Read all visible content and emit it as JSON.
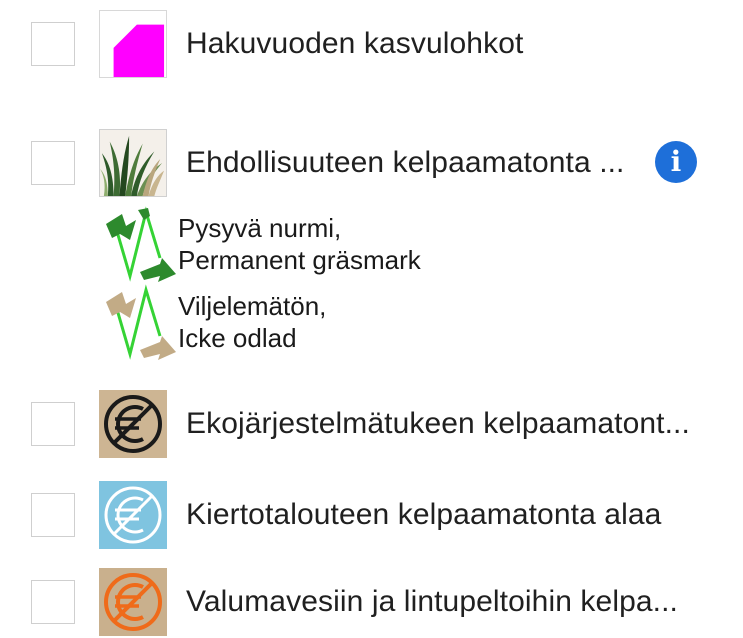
{
  "layers": [
    {
      "label": "Hakuvuoden kasvulohkot",
      "icon": "magenta-parcel-icon",
      "color": "#ff00ff"
    },
    {
      "label": "Ehdollisuuteen kelpaamatonta ...",
      "icon": "grass-icon",
      "info": "i"
    },
    {
      "label": "Ekojärjestelmätukeen kelpaamatont...",
      "icon": "crossed-euro-icon",
      "bg": "#cdb593",
      "stroke": "#1a1a1a"
    },
    {
      "label": "Kiertotalouteen kelpaamatonta alaa",
      "icon": "crossed-euro-icon",
      "bg": "#7fc4e0",
      "stroke": "#ffffff"
    },
    {
      "label": "Valumavesiin ja lintupeltoihin kelpa...",
      "icon": "crossed-euro-icon",
      "bg": "#c9b08d",
      "stroke": "#ef6b1a"
    }
  ],
  "legend": [
    {
      "line1": "Pysyvä nurmi,",
      "line2": "Permanent gräsmark",
      "arrow_color": "#2d8a2d",
      "line_color": "#35d335"
    },
    {
      "line1": "Viljelemätön,",
      "line2": "Icke odlad",
      "arrow_color": "#c2ab86",
      "line_color": "#35d335"
    }
  ]
}
